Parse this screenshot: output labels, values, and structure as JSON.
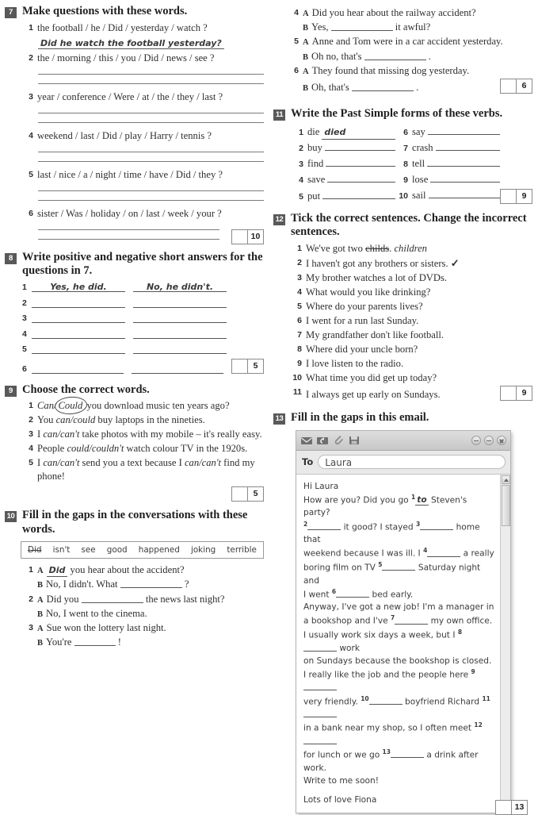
{
  "exercises": [
    {
      "number": "7",
      "title": "Make questions with these words.",
      "items": [
        {
          "num": "1",
          "text": "the football / he / Did / yesterday / watch ?",
          "answer": "Did he watch the football yesterday?"
        },
        {
          "num": "2",
          "text": "the / morning / this / you / Did / news / see ?"
        },
        {
          "num": "3",
          "text": "year / conference / Were / at / the / they / last ?"
        },
        {
          "num": "4",
          "text": "weekend / last / Did / play / Harry / tennis ?"
        },
        {
          "num": "5",
          "text": "last / nice / a / night / time / have / Did / they ?"
        },
        {
          "num": "6",
          "text": "sister / Was / holiday / on / last / week / your ?"
        }
      ],
      "score": "10"
    },
    {
      "number": "8",
      "title": "Write positive and negative short answers for the questions in 7.",
      "rows": [
        {
          "num": "1",
          "positive": "Yes, he did.",
          "negative": "No, he didn't."
        },
        {
          "num": "2",
          "positive": "",
          "negative": ""
        },
        {
          "num": "3",
          "positive": "",
          "negative": ""
        },
        {
          "num": "4",
          "positive": "",
          "negative": ""
        },
        {
          "num": "5",
          "positive": "",
          "negative": ""
        },
        {
          "num": "6",
          "positive": "",
          "negative": ""
        }
      ],
      "score": "5"
    },
    {
      "number": "9",
      "title": "Choose the correct words.",
      "score": "5"
    },
    {
      "number": "10",
      "title": "Fill in the gaps in the conversations with these words.",
      "wordbank": [
        "Did",
        "isn't",
        "see",
        "good",
        "happened",
        "joking",
        "terrible"
      ],
      "wordbank_struck": "Did",
      "score": "6"
    },
    {
      "number": "11",
      "title": "Write the Past Simple forms of these verbs.",
      "verbs_left": [
        {
          "num": "1",
          "verb": "die",
          "answer": "died"
        },
        {
          "num": "2",
          "verb": "buy",
          "answer": ""
        },
        {
          "num": "3",
          "verb": "find",
          "answer": ""
        },
        {
          "num": "4",
          "verb": "save",
          "answer": ""
        },
        {
          "num": "5",
          "verb": "put",
          "answer": ""
        }
      ],
      "verbs_right": [
        {
          "num": "6",
          "verb": "say",
          "answer": ""
        },
        {
          "num": "7",
          "verb": "crash",
          "answer": ""
        },
        {
          "num": "8",
          "verb": "tell",
          "answer": ""
        },
        {
          "num": "9",
          "verb": "lose",
          "answer": ""
        },
        {
          "num": "10",
          "verb": "sail",
          "answer": ""
        }
      ],
      "score": "9"
    },
    {
      "number": "12",
      "title": "Tick the correct sentences. Change the incorrect sentences.",
      "sentences": [
        {
          "num": "1",
          "pre": "We've got two ",
          "struck": "childs",
          "post": ".",
          "correction": "children"
        },
        {
          "num": "2",
          "text": "I haven't got any brothers or sisters.",
          "tick": "✓"
        },
        {
          "num": "3",
          "text": "My brother watches a lot of DVDs."
        },
        {
          "num": "4",
          "text": "What would you like drinking?"
        },
        {
          "num": "5",
          "text": "Where do your parents lives?"
        },
        {
          "num": "6",
          "text": "I went for a run last Sunday."
        },
        {
          "num": "7",
          "text": "My grandfather don't like football."
        },
        {
          "num": "8",
          "text": "Where did your uncle born?"
        },
        {
          "num": "9",
          "text": "I love listen to the radio."
        },
        {
          "num": "10",
          "text": "What time you did get up today?"
        },
        {
          "num": "11",
          "text": "I always get up early on Sundays."
        }
      ],
      "score": "9"
    },
    {
      "number": "13",
      "title": "Fill in the gaps in this email.",
      "score": "13"
    }
  ],
  "ex7_q1_answer": "Did he watch the football yesterday?",
  "ex7_items": {
    "i1": "the football / he / Did / yesterday / watch ?",
    "i2": "the / morning / this / you / Did / news / see ?",
    "i3": "year / conference / Were / at / the / they / last ?",
    "i4": "weekend / last / Did / play / Harry / tennis ?",
    "i5": "last / nice / a / night / time / have / Did / they ?",
    "i6": "sister / Was / holiday / on / last / week / your ?"
  },
  "ex9": {
    "q1": {
      "num": "1",
      "pre": "",
      "opt_a": "Can",
      "slash": "/",
      "opt_b": "Could",
      "post": " you download music ten years ago?"
    },
    "q2": {
      "num": "2",
      "pre": "You ",
      "choice": "can/could",
      "post": " buy laptops in the nineties."
    },
    "q3": {
      "num": "3",
      "pre": "I ",
      "choice": "can/can't",
      "post": " take photos with my mobile – it's really easy."
    },
    "q4": {
      "num": "4",
      "pre": "People ",
      "choice": "could/couldn't",
      "post": " watch colour TV in the 1920s."
    },
    "q5": {
      "num": "5",
      "pre": "I ",
      "choice": "can/can't",
      "mid": " send you a text because I ",
      "choice2": "can/can't",
      "post": " find my phone!"
    }
  },
  "ex10": {
    "c1a_speaker": "A",
    "c1a_answer": "Did",
    "c1a_text": " you hear about the accident?",
    "c1b_speaker": "B",
    "c1b_pre": "No, I didn't. What ",
    "c1b_post": " ?",
    "c2a_speaker": "A",
    "c2a_pre": "Did you ",
    "c2a_post": " the news last night?",
    "c2b_speaker": "B",
    "c2b_text": "No, I went to the cinema.",
    "c3a_speaker": "A",
    "c3a_text": "Sue won the lottery last night.",
    "c3b_speaker": "B",
    "c3b_pre": "You're ",
    "c3b_post": " !",
    "c4a_speaker": "A",
    "c4a_text": "Did you hear about the railway accident?",
    "c4b_speaker": "B",
    "c4b_pre": "Yes, ",
    "c4b_post": " it awful?",
    "c5a_speaker": "A",
    "c5a_text": "Anne and Tom were in a car accident yesterday.",
    "c5b_speaker": "B",
    "c5b_pre": "Oh no, that's ",
    "c5b_post": " .",
    "c6a_speaker": "A",
    "c6a_text": "They found that missing dog yesterday.",
    "c6b_speaker": "B",
    "c6b_pre": "Oh, that's ",
    "c6b_post": " ."
  },
  "email": {
    "toolbar_icons": [
      "mail-icon",
      "reply-icon",
      "attach-icon",
      "send-icon"
    ],
    "window_buttons": [
      "minimize-button",
      "maximize-button",
      "close-button"
    ],
    "to_label": "To",
    "to_value": "Laura",
    "line1": "Hi Laura",
    "line2_pre": "How are you? Did you go ",
    "line2_sup1": "1",
    "line2_answer": "to",
    "line2_post": " Steven's party?",
    "l3_sup": "2",
    "l3_mid": " it good? I stayed ",
    "l3_sup2": "3",
    "l3_post": " home that",
    "l4_pre": "weekend because I was ill. I ",
    "l4_sup": "4",
    "l4_post": " a really",
    "l5_pre": "boring film on TV ",
    "l5_sup": "5",
    "l5_post": " Saturday night and",
    "l6_pre": "I went ",
    "l6_sup": "6",
    "l6_post": " bed early.",
    "l7": "Anyway, I've got a new job! I'm a manager in",
    "l8_pre": "a bookshop and I've ",
    "l8_sup": "7",
    "l8_post": " my own office.",
    "l9_pre": "I usually work six days a week, but I ",
    "l9_sup": "8",
    "l9_post": " work",
    "l10": "on Sundays because the bookshop is closed.",
    "l11_pre": "I really like the job and the people here ",
    "l11_sup": "9",
    "l12_pre": "very friendly. ",
    "l12_sup": "10",
    "l12_mid": " boyfriend Richard ",
    "l12_sup2": "11",
    "l13_pre": "in a bank near my shop, so I often meet ",
    "l13_sup": "12",
    "l14_pre": "for lunch or we go ",
    "l14_sup": "13",
    "l14_post": " a drink after work.",
    "l15": "Write to me soon!",
    "l16": "Lots of love  Fiona"
  },
  "scores": {
    "ex7": "10",
    "ex8": "5",
    "ex9": "5",
    "ex10": "6",
    "ex11": "9",
    "ex12": "9",
    "ex13": "13"
  }
}
